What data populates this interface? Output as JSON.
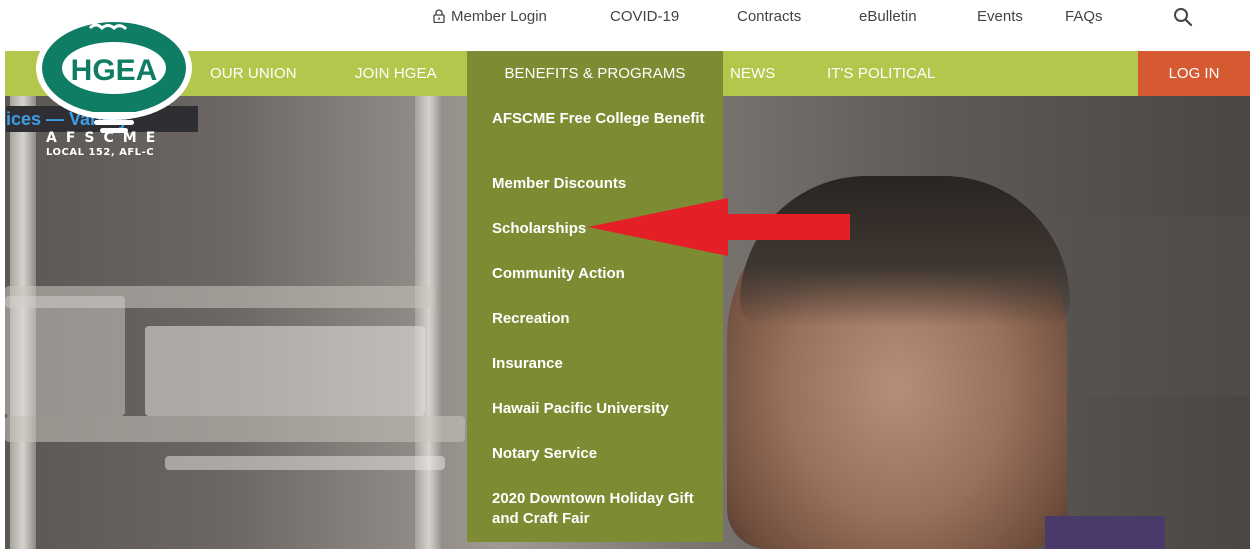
{
  "utility_nav": {
    "member_login": "Member Login",
    "covid": "COVID-19",
    "contracts": "Contracts",
    "ebulletin": "eBulletin",
    "events": "Events",
    "faqs": "FAQs",
    "search_icon": "search-icon"
  },
  "logo": {
    "text": "HGEA",
    "union": "AFSCME",
    "local": "LOCAL 152, AFL-C"
  },
  "ticker": {
    "text": "ices — Variety"
  },
  "main_nav": {
    "items": [
      {
        "label": "OUR UNION"
      },
      {
        "label": "JOIN HGEA"
      },
      {
        "label": "BENEFITS & PROGRAMS"
      },
      {
        "label": "NEWS"
      },
      {
        "label": "IT'S POLITICAL"
      }
    ],
    "login": "LOG IN"
  },
  "dropdown": {
    "items": [
      {
        "label": "AFSCME Free College Benefit"
      },
      {
        "label": "Member Discounts"
      },
      {
        "label": "Scholarships"
      },
      {
        "label": "Community Action"
      },
      {
        "label": "Recreation"
      },
      {
        "label": "Insurance"
      },
      {
        "label": "Hawaii Pacific University"
      },
      {
        "label": "Notary Service"
      },
      {
        "label": "2020 Downtown Holiday Gift and Craft Fair"
      }
    ]
  },
  "colors": {
    "nav_green": "#b4c64b",
    "dropdown_green": "#7d8c33",
    "login_orange": "#d65a31",
    "arrow_red": "#e41f26",
    "logo_teal": "#0e7d63"
  }
}
